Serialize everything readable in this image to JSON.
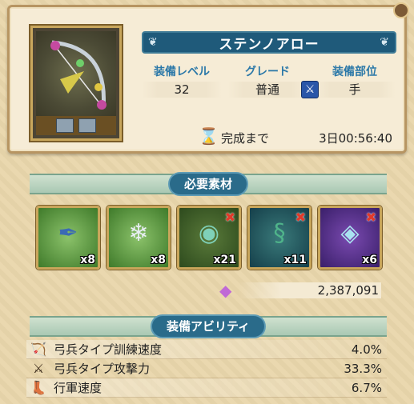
{
  "item": {
    "name": "ステンノアロー",
    "stats": {
      "level_label": "装備レベル",
      "level_value": "32",
      "grade_label": "グレード",
      "grade_value": "普通",
      "slot_label": "装備部位",
      "slot_value": "手"
    },
    "timer_label": "完成まで",
    "timer_value": "3日00:56:40"
  },
  "materials_section": {
    "title": "必要素材",
    "items": [
      {
        "icon": "feather-icon",
        "count": "x8",
        "missing": false
      },
      {
        "icon": "ice-block-icon",
        "count": "x8",
        "missing": false
      },
      {
        "icon": "amulet-icon",
        "count": "x21",
        "missing": true
      },
      {
        "icon": "serpent-icon",
        "count": "x11",
        "missing": true
      },
      {
        "icon": "crystal-drop-icon",
        "count": "x6",
        "missing": true
      }
    ],
    "cost": "2,387,091"
  },
  "abilities_section": {
    "title": "装備アビリティ",
    "rows": [
      {
        "icon": "archer-icon",
        "name": "弓兵タイプ訓練速度",
        "value": "4.0%"
      },
      {
        "icon": "sword-icon",
        "name": "弓兵タイプ攻撃力",
        "value": "33.3%"
      },
      {
        "icon": "boot-icon",
        "name": "行軍速度",
        "value": "6.7%"
      }
    ]
  },
  "colors": {
    "banner_blue": "#1f5a7a",
    "label_blue": "#2b78a8",
    "missing_red": "#e23a2a",
    "gold_frame": "#c9a65b"
  }
}
